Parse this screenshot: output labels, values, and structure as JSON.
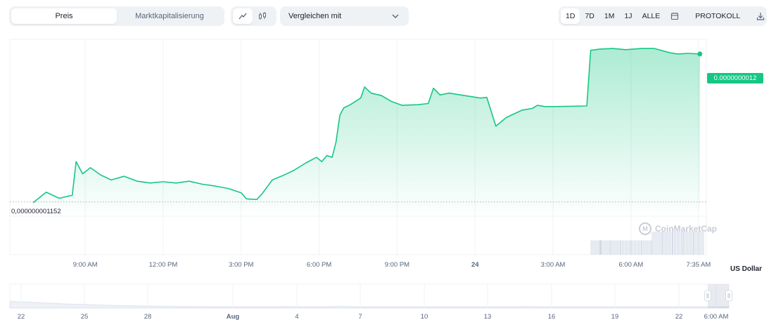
{
  "toolbar": {
    "metric_tabs": [
      {
        "label": "Preis",
        "active": true
      },
      {
        "label": "Marktkapitalisierung",
        "active": false
      }
    ],
    "chart_type_buttons": [
      {
        "icon": "line-chart-icon",
        "active": true
      },
      {
        "icon": "candlestick-icon",
        "active": false
      }
    ],
    "compare_label": "Vergleichen mit",
    "ranges": [
      {
        "label": "1D",
        "active": true
      },
      {
        "label": "7D",
        "active": false
      },
      {
        "label": "1M",
        "active": false
      },
      {
        "label": "1J",
        "active": false
      },
      {
        "label": "ALLE",
        "active": false
      }
    ],
    "calendar_icon": "calendar-icon",
    "log_label": "PROTOKOLL",
    "download_icon": "download-icon"
  },
  "current_price_label": "0.0000000012",
  "baseline_label": "0,000000001152",
  "currency_label": "US Dollar",
  "watermark": "CoinMarketCap",
  "colors": {
    "line": "#16c784",
    "fill_top": "#16c784",
    "badge_bg": "#16c784",
    "grid": "#eff2f5",
    "volume": "#cfd6e4",
    "navigator_fill": "#eef1f6",
    "handle": "#d8dee8"
  },
  "chart_data": {
    "type": "line",
    "series": [
      {
        "values": [
          [
            7.0,
            1.1523
          ],
          [
            7.5,
            1.154
          ],
          [
            8.0,
            1.153
          ],
          [
            8.5,
            1.1535
          ],
          [
            8.65,
            1.159
          ],
          [
            8.9,
            1.157
          ],
          [
            9.2,
            1.158
          ],
          [
            9.6,
            1.1568
          ],
          [
            10.0,
            1.156
          ],
          [
            10.5,
            1.1566
          ],
          [
            11.0,
            1.1558
          ],
          [
            11.5,
            1.1555
          ],
          [
            12.0,
            1.1557
          ],
          [
            12.5,
            1.1555
          ],
          [
            13.0,
            1.1558
          ],
          [
            13.5,
            1.1553
          ],
          [
            14.0,
            1.155
          ],
          [
            14.5,
            1.1546
          ],
          [
            15.0,
            1.1539
          ],
          [
            15.2,
            1.1529
          ],
          [
            15.6,
            1.1528
          ],
          [
            15.8,
            1.1537
          ],
          [
            16.2,
            1.156
          ],
          [
            16.6,
            1.1567
          ],
          [
            17.0,
            1.1575
          ],
          [
            17.5,
            1.1588
          ],
          [
            17.9,
            1.1597
          ],
          [
            18.1,
            1.159
          ],
          [
            18.3,
            1.16
          ],
          [
            18.5,
            1.1597
          ],
          [
            18.65,
            1.1622
          ],
          [
            18.8,
            1.1666
          ],
          [
            18.95,
            1.1678
          ],
          [
            19.2,
            1.1683
          ],
          [
            19.6,
            1.1694
          ],
          [
            19.75,
            1.1712
          ],
          [
            20.0,
            1.1702
          ],
          [
            20.4,
            1.1698
          ],
          [
            20.8,
            1.1688
          ],
          [
            21.2,
            1.1682
          ],
          [
            21.8,
            1.1683
          ],
          [
            22.2,
            1.1685
          ],
          [
            22.4,
            1.171
          ],
          [
            22.65,
            1.1699
          ],
          [
            23.0,
            1.1702
          ],
          [
            23.6,
            1.1698
          ],
          [
            24.2,
            1.1694
          ],
          [
            24.45,
            1.1695
          ],
          [
            24.8,
            1.1648
          ],
          [
            25.2,
            1.1662
          ],
          [
            25.8,
            1.1674
          ],
          [
            26.2,
            1.1677
          ],
          [
            26.4,
            1.1682
          ],
          [
            26.7,
            1.168
          ],
          [
            27.0,
            1.168
          ],
          [
            28.3,
            1.1681
          ],
          [
            28.45,
            1.1772
          ],
          [
            28.8,
            1.1774
          ],
          [
            29.3,
            1.1775
          ],
          [
            29.8,
            1.1773
          ],
          [
            30.4,
            1.1775
          ],
          [
            30.9,
            1.1775
          ],
          [
            31.5,
            1.1768
          ],
          [
            31.8,
            1.1766
          ],
          [
            32.2,
            1.1767
          ],
          [
            32.65,
            1.1766
          ]
        ]
      }
    ],
    "x_ticks": [
      {
        "value": 9,
        "label": "9:00 AM"
      },
      {
        "value": 12,
        "label": "12:00 PM"
      },
      {
        "value": 15,
        "label": "3:00 PM"
      },
      {
        "value": 18,
        "label": "6:00 PM"
      },
      {
        "value": 21,
        "label": "9:00 PM"
      },
      {
        "value": 24,
        "label": "24"
      },
      {
        "value": 27,
        "label": "3:00 AM"
      },
      {
        "value": 30,
        "label": "6:00 AM"
      },
      {
        "value": 32.6,
        "label": "7:35 AM"
      }
    ],
    "xlim": [
      6.1,
      32.9
    ],
    "ylim": [
      1.151,
      1.179
    ],
    "baseline": 1.1524,
    "last_value": 1.1766,
    "y_unit": "e-9 USD",
    "grid": true,
    "volume": {
      "bars": [
        [
          28.45,
          0.62
        ],
        [
          28.8,
          0.62
        ],
        [
          29.2,
          0.62
        ],
        [
          29.6,
          0.62
        ],
        [
          30.0,
          0.62
        ],
        [
          30.4,
          0.62
        ],
        [
          30.8,
          1.0
        ],
        [
          31.2,
          1.0
        ],
        [
          31.6,
          1.0
        ],
        [
          32.0,
          1.0
        ],
        [
          32.4,
          1.0
        ]
      ]
    },
    "navigator": {
      "ticks": [
        "22",
        "25",
        "28",
        "Aug",
        "4",
        "7",
        "10",
        "13",
        "16",
        "19",
        "22",
        "6:00 AM"
      ],
      "profile": [
        0.55,
        0.5,
        0.42,
        0.35,
        0.3,
        0.25,
        0.2,
        0.18,
        0.15,
        0.13,
        0.12,
        0.11,
        0.1,
        0.1,
        0.1,
        0.12,
        0.1,
        0.1,
        0.14,
        0.1,
        0.1,
        0.1,
        0.1,
        0.1,
        0.1,
        0.1,
        0.1,
        0.1,
        0.12,
        0.1,
        0.1,
        0.1,
        0.1,
        0.1,
        0.1,
        0.1,
        0.1,
        0.1,
        0.1,
        0.1
      ]
    }
  }
}
